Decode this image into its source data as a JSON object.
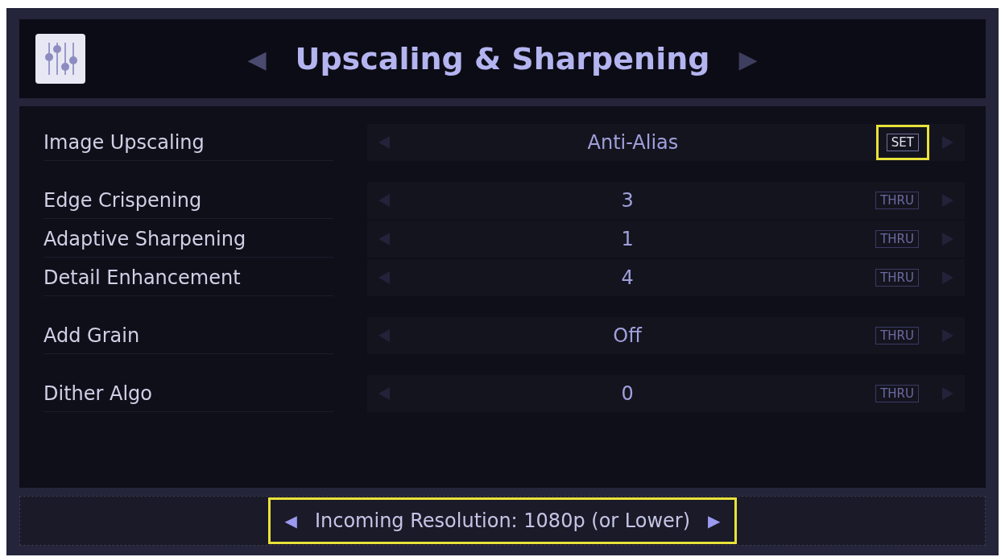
{
  "header": {
    "title": "Upscaling & Sharpening",
    "prev_arrow": "◀",
    "next_arrow": "▶"
  },
  "groups": [
    [
      {
        "label": "Image Upscaling",
        "value": "Anti-Alias",
        "badge": "SET",
        "badge_active": true,
        "highlighted": true
      }
    ],
    [
      {
        "label": "Edge Crispening",
        "value": "3",
        "badge": "THRU",
        "badge_active": false,
        "highlighted": false
      },
      {
        "label": "Adaptive Sharpening",
        "value": "1",
        "badge": "THRU",
        "badge_active": false,
        "highlighted": false
      },
      {
        "label": "Detail Enhancement",
        "value": "4",
        "badge": "THRU",
        "badge_active": false,
        "highlighted": false
      }
    ],
    [
      {
        "label": "Add Grain",
        "value": "Off",
        "badge": "THRU",
        "badge_active": false,
        "highlighted": false
      }
    ],
    [
      {
        "label": "Dither Algo",
        "value": "0",
        "badge": "THRU",
        "badge_active": false,
        "highlighted": false
      }
    ]
  ],
  "footer": {
    "text": "Incoming Resolution: 1080p (or Lower)",
    "prev_arrow": "◀",
    "next_arrow": "▶",
    "highlighted": true
  }
}
